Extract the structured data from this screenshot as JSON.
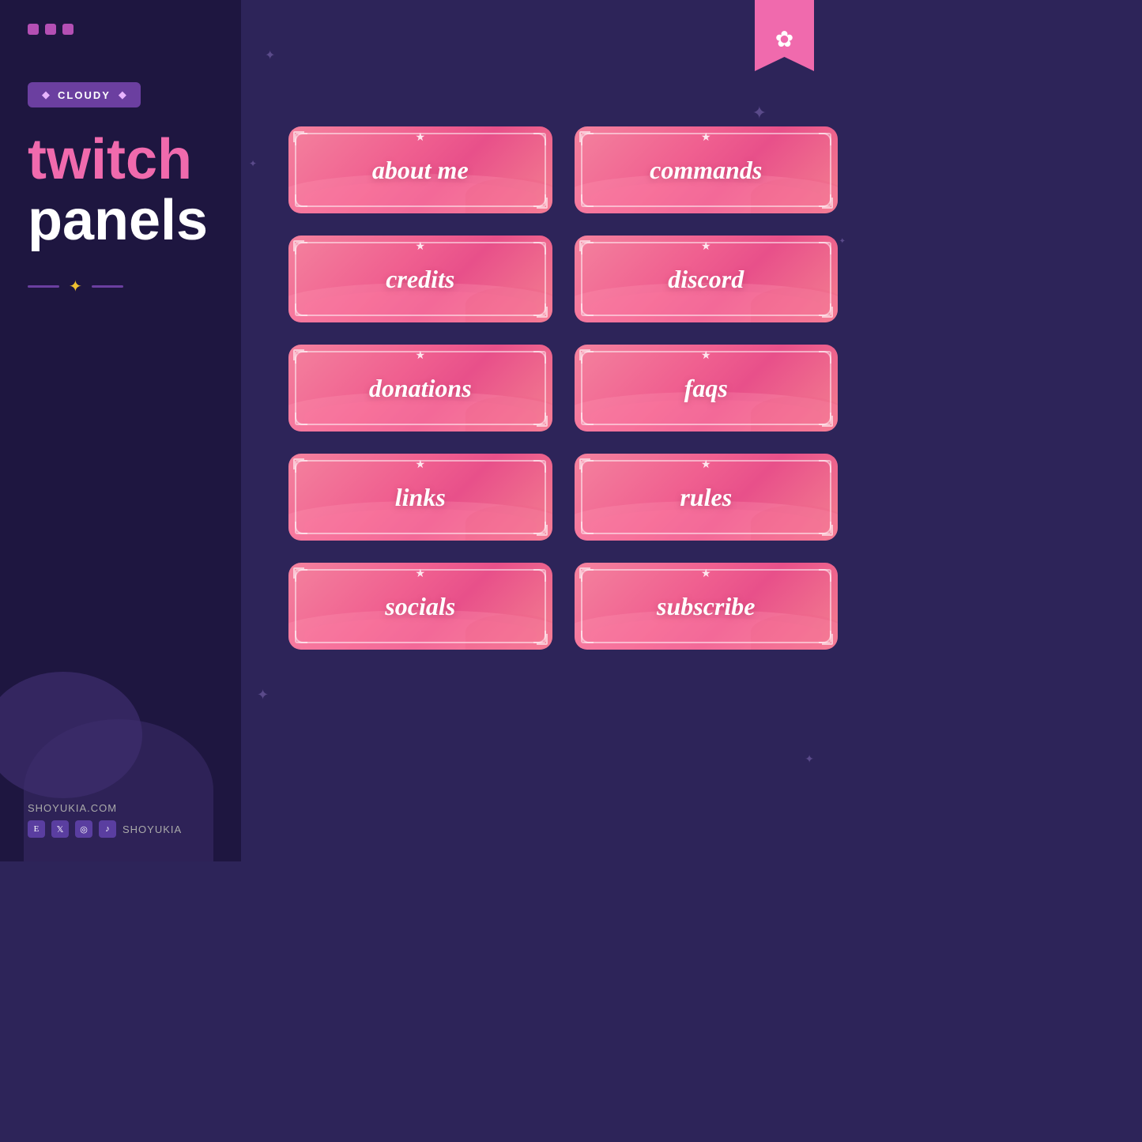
{
  "sidebar": {
    "dots": [
      "dot1",
      "dot2",
      "dot3"
    ],
    "badge": {
      "text": "CLOUDY",
      "diamond_left": "◆",
      "diamond_right": "◆"
    },
    "title_line1": "twitch",
    "title_line2": "panels",
    "divider_diamond": "✦",
    "footer": {
      "website": "SHOYUKIA.COM",
      "handle": "SHOYUKIA"
    }
  },
  "panels": [
    {
      "label": "about me",
      "id": "about-me"
    },
    {
      "label": "commands",
      "id": "commands"
    },
    {
      "label": "credits",
      "id": "credits"
    },
    {
      "label": "discord",
      "id": "discord"
    },
    {
      "label": "donations",
      "id": "donations"
    },
    {
      "label": "faqs",
      "id": "faqs"
    },
    {
      "label": "links",
      "id": "links"
    },
    {
      "label": "rules",
      "id": "rules"
    },
    {
      "label": "socials",
      "id": "socials"
    },
    {
      "label": "subscribe",
      "id": "subscribe"
    }
  ],
  "sparkles": [
    "✦",
    "✦",
    "✦",
    "✦",
    "✦"
  ],
  "star": "★",
  "bookmark_icon": "✿"
}
